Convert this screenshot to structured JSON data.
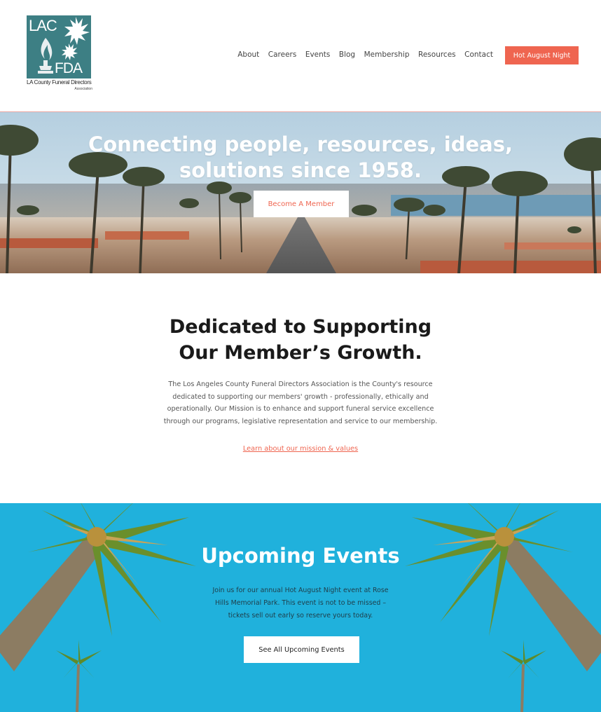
{
  "header": {
    "logo": {
      "top_text": "LAC",
      "bottom_text": "FDA",
      "caption": "LA County Funeral Directors",
      "subcaption": "Association"
    },
    "nav": [
      {
        "label": "About"
      },
      {
        "label": "Careers"
      },
      {
        "label": "Events"
      },
      {
        "label": "Blog"
      },
      {
        "label": "Membership"
      },
      {
        "label": "Resources"
      },
      {
        "label": "Contact"
      }
    ],
    "cta_label": "Hot August Night"
  },
  "hero": {
    "title_line1": "Connecting people, resources, ideas,",
    "title_line2": "solutions since 1958.",
    "button_label": "Become A Member"
  },
  "mission": {
    "title_line1": "Dedicated to Supporting",
    "title_line2": "Our Member’s Growth.",
    "body": "The Los Angeles County Funeral Directors Association is the County's resource dedicated to supporting our members' growth - professionally, ethically and operationally. Our Mission is to enhance and support funeral service excellence through our programs, legislative representation and service to our membership.",
    "link_label": "Learn about our mission & values"
  },
  "events": {
    "title": "Upcoming Events",
    "body": "Join us for our annual Hot August Night event at Rose Hills Memorial Park. This event is not to be missed – tickets sell out early so reserve yours today.",
    "button_label": "See All Upcoming Events"
  },
  "colors": {
    "accent": "#ef6550",
    "logo_teal": "#3d7f84",
    "events_bg": "#20b1dc"
  },
  "icons": {
    "logo_flame": "flame-icon",
    "logo_palm": "palm-tree-icon"
  }
}
